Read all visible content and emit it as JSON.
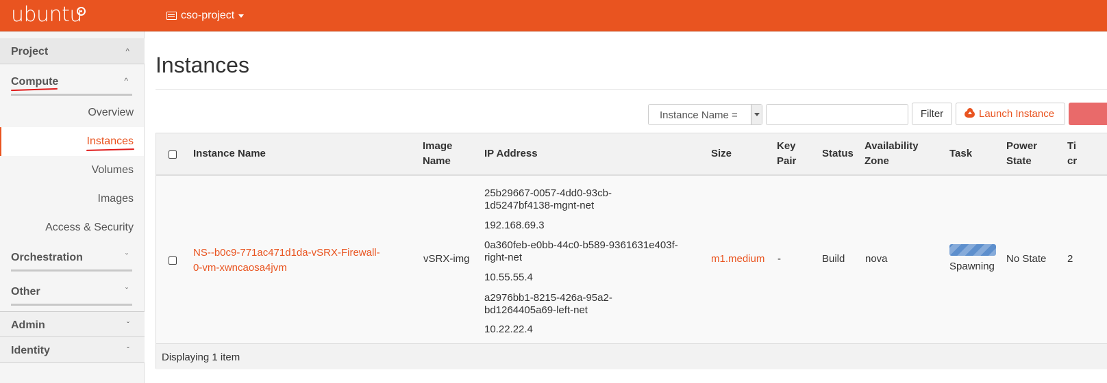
{
  "topbar": {
    "logo_text": "ubuntu",
    "project": "cso-project",
    "brand_color": "#e95420"
  },
  "sidebar": {
    "project_label": "Project",
    "compute_label": "Compute",
    "items": [
      "Overview",
      "Instances",
      "Volumes",
      "Images",
      "Access & Security"
    ],
    "active_item": "Instances",
    "orchestration_label": "Orchestration",
    "other_label": "Other",
    "admin_label": "Admin",
    "identity_label": "Identity"
  },
  "main": {
    "title": "Instances",
    "filter": {
      "select_value": "Instance Name =",
      "input_value": "",
      "filter_button": "Filter",
      "launch_button": "Launch Instance"
    },
    "table": {
      "headers": {
        "name": "Instance Name",
        "image_line1": "Image",
        "image_line2": "Name",
        "ip": "IP Address",
        "size": "Size",
        "key_line1": "Key",
        "key_line2": "Pair",
        "status": "Status",
        "az_line1": "Availability",
        "az_line2": "Zone",
        "task": "Task",
        "power_line1": "Power",
        "power_line2": "State",
        "time_line1": "Ti",
        "time_line2": "cr"
      },
      "rows": [
        {
          "name_line1": "NS--b0c9-771ac471d1da-vSRX-Firewall-",
          "name_line2": "0-vm-xwncaosa4jvm",
          "image": "vSRX-img",
          "ip": [
            {
              "net_line1": "25b29667-0057-4dd0-93cb-",
              "net_line2": "1d5247bf4138-mgnt-net",
              "addr": "192.168.69.3"
            },
            {
              "net_line1": "0a360feb-e0bb-44c0-b589-9361631e403f-",
              "net_line2": "right-net",
              "addr": "10.55.55.4"
            },
            {
              "net_line1": "a2976bb1-8215-426a-95a2-",
              "net_line2": "bd1264405a69-left-net",
              "addr": "10.22.22.4"
            }
          ],
          "size": "m1.medium",
          "key_pair": "-",
          "status": "Build",
          "az": "nova",
          "task": "Spawning",
          "power_state": "No State",
          "time": "2"
        }
      ],
      "footer": "Displaying 1 item"
    }
  }
}
